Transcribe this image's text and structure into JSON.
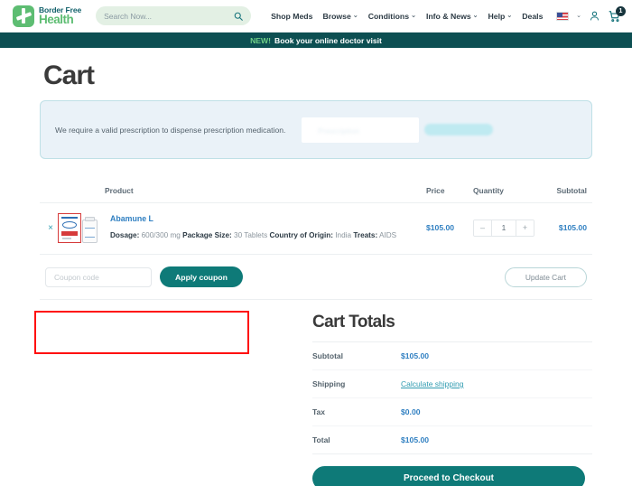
{
  "header": {
    "logo": {
      "top": "Border Free",
      "bottom": "Health"
    },
    "search": {
      "placeholder": "Search Now...",
      "value": ""
    },
    "nav": [
      {
        "label": "Shop Meds",
        "has_caret": false
      },
      {
        "label": "Browse",
        "has_caret": true
      },
      {
        "label": "Conditions",
        "has_caret": true
      },
      {
        "label": "Info & News",
        "has_caret": true
      },
      {
        "label": "Help",
        "has_caret": true
      },
      {
        "label": "Deals",
        "has_caret": false
      }
    ],
    "cart_badge": "1"
  },
  "announcement": {
    "tag": "NEW!",
    "text": "Book your online doctor visit"
  },
  "page": {
    "title": "Cart"
  },
  "notice": {
    "text": "We require a valid prescription to dispense prescription medication."
  },
  "table": {
    "headers": {
      "product": "Product",
      "price": "Price",
      "quantity": "Quantity",
      "subtotal": "Subtotal"
    },
    "rows": [
      {
        "remove": "×",
        "name": "Abamune L",
        "meta": [
          {
            "label": "Dosage:",
            "value": "600/300 mg"
          },
          {
            "label": "Package Size:",
            "value": "30 Tablets"
          },
          {
            "label": "Country of Origin:",
            "value": "India"
          },
          {
            "label": "Treats:",
            "value": "AIDS"
          }
        ],
        "price": "$105.00",
        "qty_minus": "–",
        "qty_value": "1",
        "qty_plus": "+",
        "subtotal": "$105.00"
      }
    ]
  },
  "coupon": {
    "placeholder": "Coupon code",
    "value": "",
    "apply_label": "Apply coupon",
    "update_label": "Update Cart"
  },
  "totals": {
    "title": "Cart Totals",
    "rows": [
      {
        "label": "Subtotal",
        "value": "$105.00",
        "is_link": false
      },
      {
        "label": "Shipping",
        "value": "Calculate shipping",
        "is_link": true
      },
      {
        "label": "Tax",
        "value": "$0.00",
        "is_link": false
      },
      {
        "label": "Total",
        "value": "$105.00",
        "is_link": false
      }
    ],
    "checkout_label": "Proceed to Checkout"
  },
  "colors": {
    "teal": "#0e7a78",
    "dark_teal": "#0d4f52",
    "green": "#5dbd72",
    "link_blue": "#2f7fc1",
    "annotation_red": "#ff0d0d"
  }
}
